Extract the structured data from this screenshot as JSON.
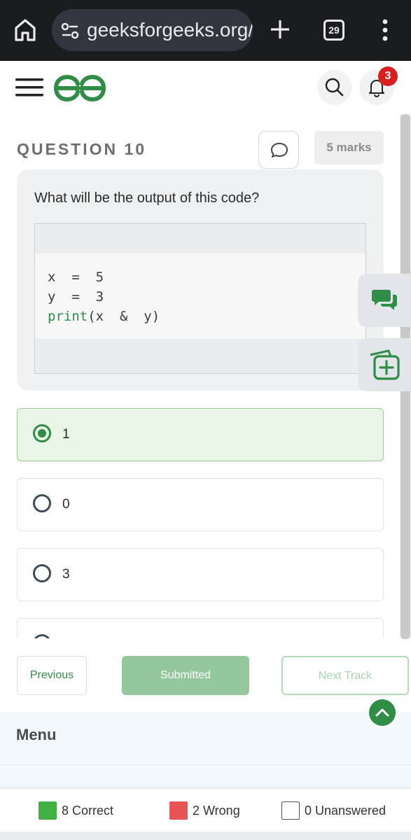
{
  "browser": {
    "url": "geeksforgeeks.org/b",
    "tab_count": "29"
  },
  "header": {
    "notification_count": "3"
  },
  "question": {
    "title": "QUESTION 10",
    "marks": "5 marks",
    "text": "What will be the output of this code?",
    "code": [
      {
        "plain": "x  =  5"
      },
      {
        "plain": "y  =  3"
      },
      {
        "keyword": "print",
        "rest": "(x  &  y)"
      }
    ]
  },
  "options": [
    {
      "label": "1",
      "selected": true
    },
    {
      "label": "0",
      "selected": false
    },
    {
      "label": "3",
      "selected": false
    }
  ],
  "nav": {
    "previous": "Previous",
    "submitted": "Submitted",
    "next_track": "Next Track"
  },
  "menu": {
    "label": "Menu"
  },
  "legend": {
    "correct": "8 Correct",
    "wrong": "2 Wrong",
    "unanswered": "0 Unanswered"
  },
  "colors": {
    "brand_green": "#2f8d46",
    "correct": "#3fb041",
    "wrong": "#e85454",
    "badge_red": "#d91e1e"
  },
  "icons": [
    "home-icon",
    "site-settings-icon",
    "new-tab-icon",
    "more-options-icon",
    "menu-icon",
    "search-icon",
    "bell-icon",
    "comment-icon",
    "chat-icon",
    "add-note-icon",
    "chevron-up-icon"
  ]
}
